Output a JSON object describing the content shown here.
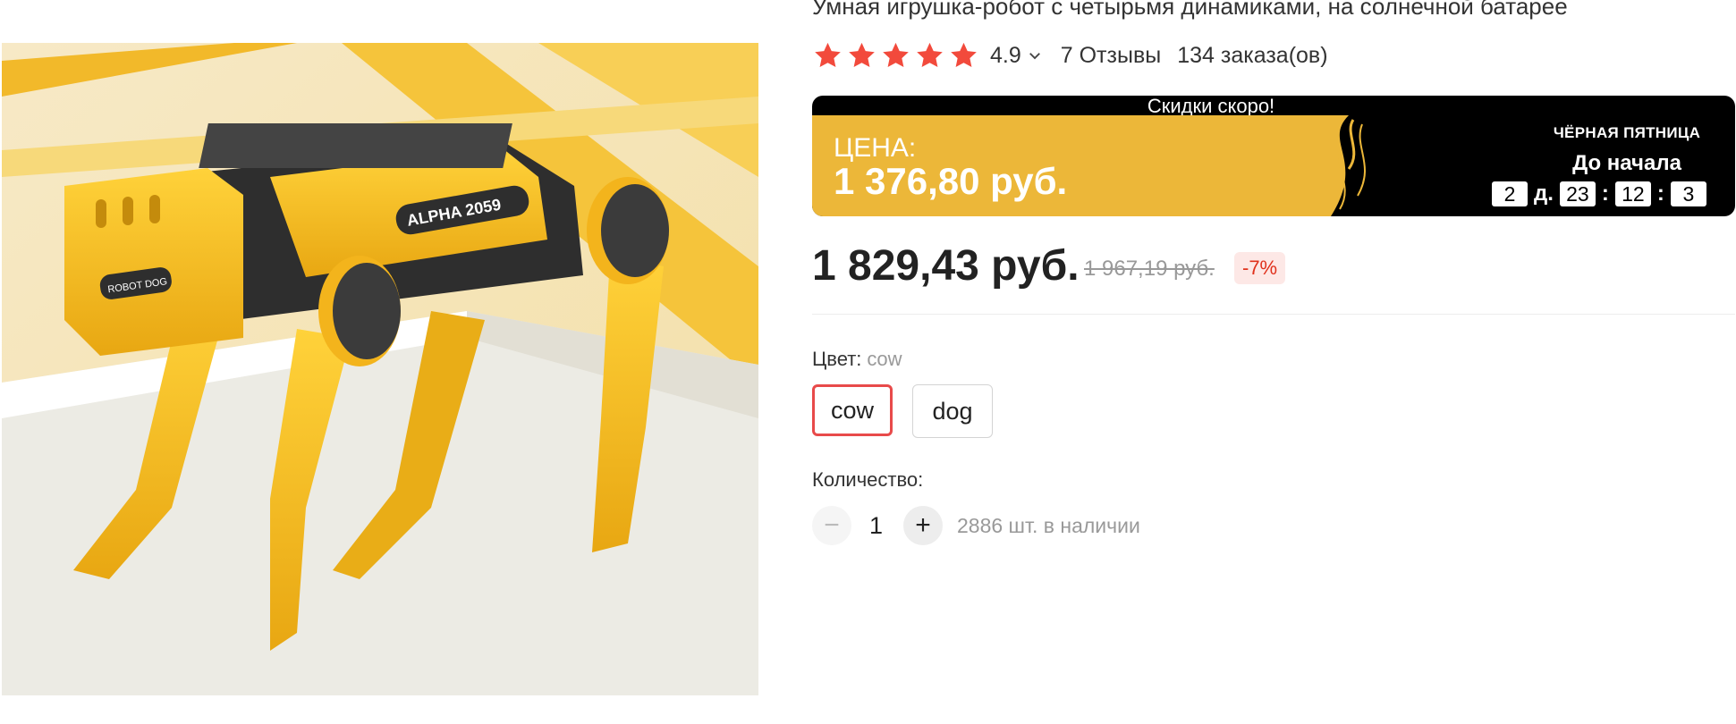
{
  "product": {
    "title": "Умная игрушка-робот с четырьмя динамиками, на солнечной батарее",
    "image_texts": [
      "ALPHA 2059",
      "ROBOT DOG"
    ],
    "rating": "4.9",
    "rating_stars": 5,
    "reviews": "7 Отзывы",
    "orders": "134 заказа(ов)"
  },
  "promo": {
    "top_text": "Скидки скоро!",
    "price_label": "ЦЕНА:",
    "price_value": "1 376,80 руб.",
    "event_title": "ЧЁРНАЯ ПЯТНИЦА",
    "event_subtitle": "До начала",
    "countdown": {
      "days": "2",
      "days_unit": "д.",
      "hours": "23",
      "minutes": "12",
      "seconds": "3",
      "separator": ":"
    }
  },
  "pricing": {
    "current": "1 829,43 руб.",
    "old": "1 967,19 руб.",
    "discount": "-7%"
  },
  "color": {
    "label": "Цвет:",
    "selected": "cow",
    "options": [
      "cow",
      "dog"
    ]
  },
  "quantity": {
    "label": "Количество:",
    "minus": "−",
    "value": "1",
    "plus": "+",
    "stock": "2886 шт. в наличии"
  },
  "colors": {
    "star": "#f24a3c",
    "promo_yellow": "#ecb739",
    "discount_red": "#e0311c",
    "selected_border": "#e84a4a"
  }
}
